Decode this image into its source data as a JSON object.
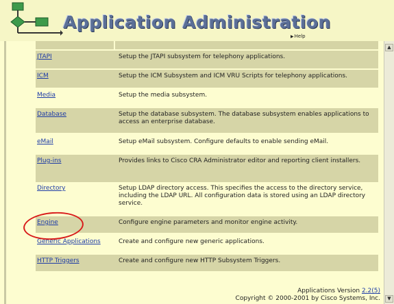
{
  "header": {
    "title": "Application Administration",
    "help_label": "Help"
  },
  "items": [
    {
      "name": "JTAPI",
      "description": "Setup the JTAPI subsystem for telephony applications."
    },
    {
      "name": "ICM",
      "description": "Setup the ICM Subsystem and ICM VRU Scripts for telephony applications."
    },
    {
      "name": "Media",
      "description": "Setup the media subsystem."
    },
    {
      "name": "Database",
      "description": "Setup the database subsystem. The database subsystem enables applications to access an enterprise database."
    },
    {
      "name": "eMail",
      "description": "Setup eMail subsystem. Configure defaults to enable sending eMail."
    },
    {
      "name": "Plug-ins",
      "description": "Provides links to Cisco CRA Administrator editor and reporting client installers."
    },
    {
      "name": "Directory",
      "description": "Setup LDAP directory access. This specifies the access to the directory service, including the LDAP URL. All configuration data is stored using an LDAP directory service."
    },
    {
      "name": "Engine",
      "description": "Configure engine parameters and monitor engine activity."
    },
    {
      "name": "Generic Applications",
      "description": "Create and configure new generic applications."
    },
    {
      "name": "HTTP Triggers",
      "description": "Create and configure new HTTP Subsystem Triggers."
    }
  ],
  "footer": {
    "version_prefix": "Applications Version ",
    "version_link": "2.2(5)",
    "copyright": "Copyright © 2000-2001 by Cisco Systems, Inc."
  },
  "annotation": {
    "highlighted_item": "Engine",
    "circle_color": "#d81a1a"
  },
  "colors": {
    "background": "#fdfdd0",
    "row_fill": "#d6d5a7",
    "link": "#1c3aa6",
    "title": "#5b6f97"
  }
}
